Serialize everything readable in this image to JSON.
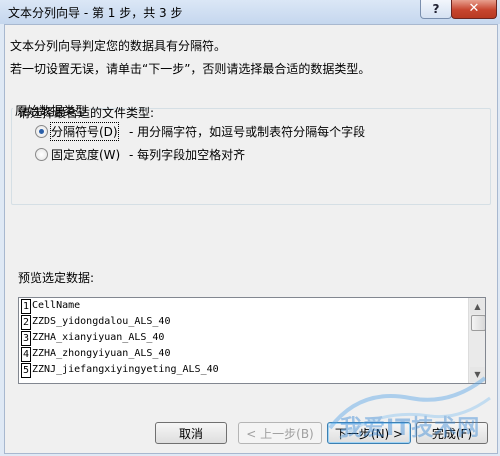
{
  "window": {
    "title": "文本分列向导 - 第 1 步，共 3 步",
    "help_label": "?",
    "close_label": "✕"
  },
  "step1": {
    "intro1": "文本分列向导判定您的数据具有分隔符。",
    "intro2": "若一切设置无误，请单击“下一步”，否则请选择最合适的数据类型。",
    "group_label": "原始数据类型",
    "file_type_prompt": "请选择最合适的文件类型:",
    "options": [
      {
        "label": "分隔符号(D)",
        "description": "- 用分隔字符，如逗号或制表符分隔每个字段",
        "selected": true
      },
      {
        "label": "固定宽度(W)",
        "description": "- 每列字段加空格对齐",
        "selected": false
      }
    ]
  },
  "preview": {
    "label": "预览选定数据:",
    "rows": [
      {
        "num": "1",
        "text": "CellName"
      },
      {
        "num": "2",
        "text": "ZZDS_yidongdalou_ALS_40"
      },
      {
        "num": "3",
        "text": "ZZHA_xianyiyuan_ALS_40"
      },
      {
        "num": "4",
        "text": "ZZHA_zhongyiyuan_ALS_40"
      },
      {
        "num": "5",
        "text": "ZZNJ_jiefangxiyingyeting_ALS_40"
      }
    ]
  },
  "buttons": {
    "cancel": "取消",
    "back": "< 上一步(B)",
    "next": "下一步(N) >",
    "finish": "完成(F)"
  },
  "watermark": {
    "text": "我爱IT技术网"
  }
}
